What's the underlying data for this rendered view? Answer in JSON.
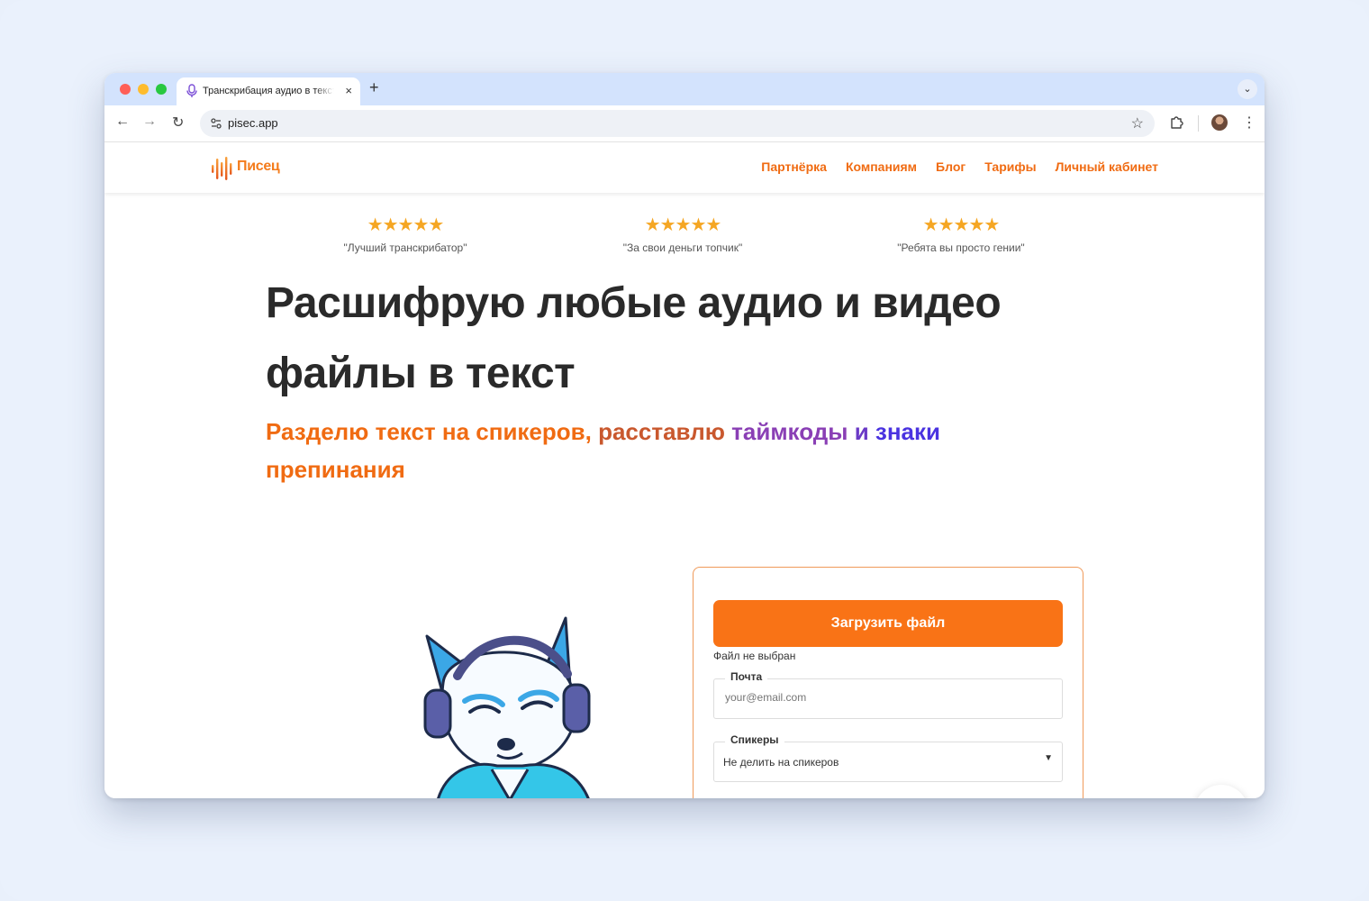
{
  "browser": {
    "tab_title": "Транскрибация аудио в текст",
    "tab_close": "×",
    "new_tab": "+",
    "tab_menu": "⌄",
    "url": "pisec.app",
    "back": "←",
    "forward": "→",
    "reload": "↻",
    "bookmark": "☆",
    "menu": "⋮"
  },
  "site": {
    "logo_text": "Писец",
    "brand_color": "#f97316",
    "nav": [
      {
        "label": "Партнёрка"
      },
      {
        "label": "Компаниям"
      },
      {
        "label": "Блог"
      },
      {
        "label": "Тарифы"
      },
      {
        "label": "Личный кабинет"
      }
    ]
  },
  "reviews": [
    {
      "rating": 5,
      "stars": "★★★★★",
      "quote": "\"Лучший транскрибатор\""
    },
    {
      "rating": 5,
      "stars": "★★★★★",
      "quote": "\"За свои деньги топчик\""
    },
    {
      "rating": 5,
      "stars": "★★★★★",
      "quote": "\"Ребята вы просто гении\""
    }
  ],
  "hero": {
    "title_line1": "Расшифрую любые аудио и видео",
    "title_line2": "файлы в текст",
    "subtitle": {
      "part1": "Разделю текст на спикеров, ",
      "part2": "расставлю ",
      "part3": "таймкоды ",
      "part4": "и ",
      "part5": "знаки",
      "part6": "препинания"
    }
  },
  "form": {
    "upload_label": "Загрузить файл",
    "file_status": "Файл не выбран",
    "email_label": "Почта",
    "email_placeholder": "your@email.com",
    "speakers_label": "Спикеры",
    "speakers_value": "Не делить на спикеров"
  },
  "help": {
    "label": "?",
    "color": "#3ecf8e"
  }
}
